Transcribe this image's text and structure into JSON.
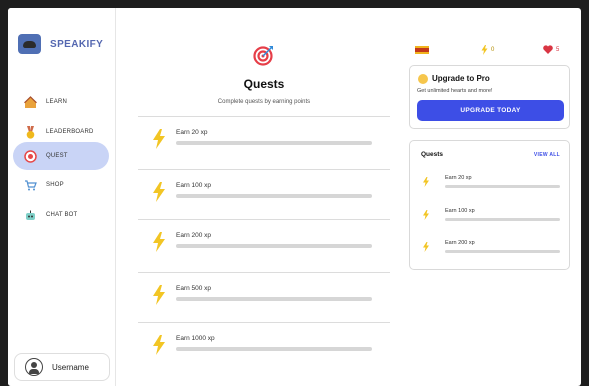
{
  "brand": {
    "name": "SPEAKIFY"
  },
  "sidebar": {
    "items": [
      {
        "label": "LEARN",
        "icon": "home-icon"
      },
      {
        "label": "LEADERBOARD",
        "icon": "medal-icon"
      },
      {
        "label": "QUEST",
        "icon": "target-icon",
        "active": true
      },
      {
        "label": "SHOP",
        "icon": "cart-icon"
      },
      {
        "label": "CHAT BOT",
        "icon": "robot-icon"
      }
    ],
    "user": {
      "name": "Username",
      "icon": "user-avatar-icon"
    }
  },
  "main": {
    "icon": "target-arrow-icon",
    "title": "Quests",
    "subtitle": "Complete quests by earning points",
    "quests": [
      {
        "label": "Earn 20 xp",
        "progress": 0
      },
      {
        "label": "Earn 100 xp",
        "progress": 0
      },
      {
        "label": "Earn 200 xp",
        "progress": 0
      },
      {
        "label": "Earn 500 xp",
        "progress": 0
      },
      {
        "label": "Earn 1000 xp",
        "progress": 0
      }
    ]
  },
  "stats": {
    "language_flag": "spain-flag-icon",
    "xp": "0",
    "hearts": "5"
  },
  "pro": {
    "title": "Upgrade to Pro",
    "subtitle": "Get unlimited hearts and more!",
    "button": "UPGRADE TODAY"
  },
  "side_quests": {
    "title": "Quests",
    "view_all": "VIEW ALL",
    "items": [
      {
        "label": "Earn 20 xp",
        "progress": 0
      },
      {
        "label": "Earn 100 xp",
        "progress": 0
      },
      {
        "label": "Earn 200 xp",
        "progress": 0
      }
    ]
  },
  "colors": {
    "accent": "#3d4ee6",
    "active_nav": "#c9d4f6",
    "xp_yellow": "#f2c524",
    "heart_red": "#d93543"
  }
}
